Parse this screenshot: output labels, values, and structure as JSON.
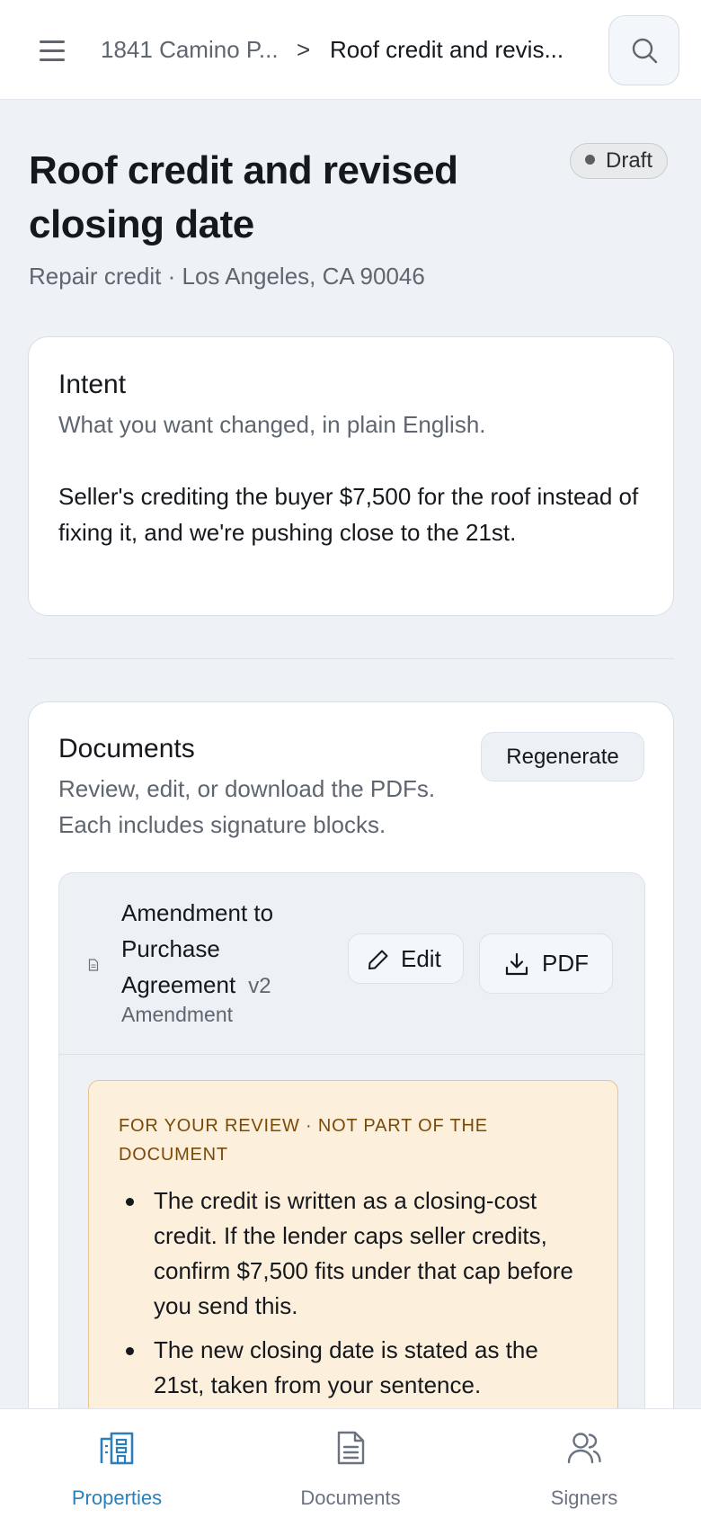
{
  "header": {
    "breadcrumb_property": "1841 Camino P...",
    "breadcrumb_separator": ">",
    "breadcrumb_current": "Roof credit and revis..."
  },
  "page": {
    "title": "Roof credit and revised closing date",
    "status": "Draft",
    "subtitle": "Repair credit · Los Angeles, CA 90046"
  },
  "intent": {
    "title": "Intent",
    "description": "What you want changed, in plain English.",
    "body": "Seller's crediting the buyer $7,500 for the roof instead of fixing it, and we're pushing close to the 21st."
  },
  "documents": {
    "title": "Documents",
    "description": "Review, edit, or download the PDFs. Each includes signature blocks.",
    "regenerate_label": "Regenerate",
    "items": [
      {
        "title": "Amendment to Purchase Agreement",
        "version": "v2",
        "type": "Amendment",
        "edit_label": "Edit",
        "pdf_label": "PDF",
        "review": {
          "heading": "FOR YOUR REVIEW · NOT PART OF THE DOCUMENT",
          "notes": [
            "The credit is written as a closing-cost credit. If the lender caps seller credits, confirm $7,500 fits under that cap before you send this.",
            "The new closing date is stated as the 21st, taken from your sentence."
          ]
        }
      }
    ]
  },
  "bottom_nav": {
    "items": [
      {
        "label": "Properties",
        "icon": "building-icon",
        "active": true
      },
      {
        "label": "Documents",
        "icon": "document-icon",
        "active": false
      },
      {
        "label": "Signers",
        "icon": "users-icon",
        "active": false
      }
    ]
  },
  "colors": {
    "accent": "#2c7fb8",
    "background": "#eef1f6",
    "review_background": "#fcefdb",
    "review_heading": "#7a4a08"
  }
}
